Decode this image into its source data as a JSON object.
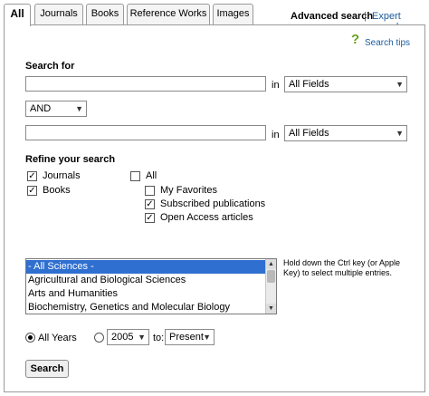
{
  "tabs": [
    {
      "label": "All",
      "active": true
    },
    {
      "label": "Journals"
    },
    {
      "label": "Books"
    },
    {
      "label": "Reference Works"
    },
    {
      "label": "Images"
    }
  ],
  "header": {
    "advanced_search": "Advanced search",
    "separator": "|",
    "expert_search": "Expert search"
  },
  "search_tips": {
    "icon": "?",
    "label": "Search tips"
  },
  "search_for": {
    "heading": "Search for",
    "term1": {
      "value": "",
      "in_label": "in",
      "field": "All Fields"
    },
    "operator": "AND",
    "term2": {
      "value": "",
      "in_label": "in",
      "field": "All Fields"
    }
  },
  "refine": {
    "heading": "Refine your search",
    "content_types": [
      {
        "label": "Journals",
        "checked": true
      },
      {
        "label": "Books",
        "checked": true
      }
    ],
    "access": {
      "all": {
        "label": "All",
        "checked": false
      },
      "options": [
        {
          "label": "My Favorites",
          "checked": false
        },
        {
          "label": "Subscribed publications",
          "checked": true
        },
        {
          "label": "Open Access articles",
          "checked": true
        }
      ]
    }
  },
  "subjects": {
    "items": [
      {
        "label": "- All Sciences -",
        "selected": true
      },
      {
        "label": "Agricultural and Biological Sciences"
      },
      {
        "label": "Arts and Humanities"
      },
      {
        "label": "Biochemistry, Genetics and Molecular Biology"
      }
    ],
    "hint": "Hold down the Ctrl key (or Apple Key) to select multiple entries."
  },
  "date_range": {
    "all_years": {
      "label": "All Years",
      "selected": true
    },
    "from_year": "2005",
    "to_label": "to:",
    "to_year": "Present"
  },
  "search_button": "Search",
  "colors": {
    "link": "#1a5c9e",
    "tips_icon": "#6aa31f",
    "selection": "#2f6fd0"
  }
}
